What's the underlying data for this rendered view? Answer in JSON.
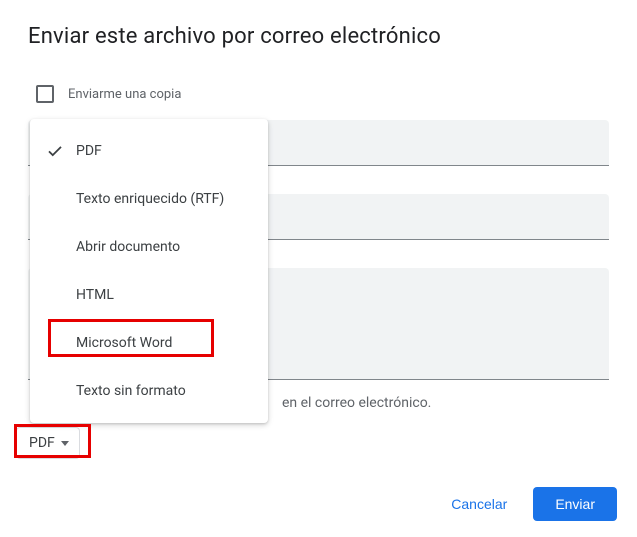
{
  "dialog": {
    "title": "Enviar este archivo por correo electrónico",
    "send_copy_label": "Enviarme una copia",
    "hint_suffix": "en el correo electrónico.",
    "cancel_label": "Cancelar",
    "send_label": "Enviar"
  },
  "format_button": {
    "selected": "PDF"
  },
  "menu": {
    "items": [
      {
        "label": "PDF",
        "checked": true
      },
      {
        "label": "Texto enriquecido (RTF)",
        "checked": false
      },
      {
        "label": "Abrir documento",
        "checked": false
      },
      {
        "label": "HTML",
        "checked": false
      },
      {
        "label": "Microsoft Word",
        "checked": false
      },
      {
        "label": "Texto sin formato",
        "checked": false
      }
    ]
  }
}
